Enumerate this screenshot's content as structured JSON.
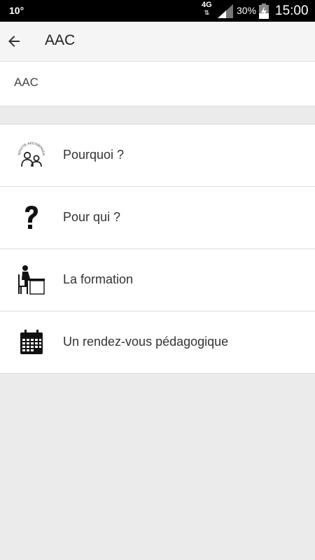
{
  "status_bar": {
    "left_text": "10°",
    "network": "4G",
    "battery_percent": "30%",
    "time": "15:00"
  },
  "app_bar": {
    "title": "AAC",
    "back_icon": "arrow-left-icon"
  },
  "subheader": {
    "title": "AAC"
  },
  "menu": {
    "items": [
      {
        "label": "Pourquoi ?",
        "icon": "conduite-accompagnee-icon",
        "icon_text": "CONDUITE ACCOMPAGNÉE"
      },
      {
        "label": "Pour qui ?",
        "icon": "question-mark-icon"
      },
      {
        "label": "La formation",
        "icon": "student-desk-icon"
      },
      {
        "label": "Un rendez-vous pédagogique",
        "icon": "calendar-icon"
      }
    ]
  }
}
